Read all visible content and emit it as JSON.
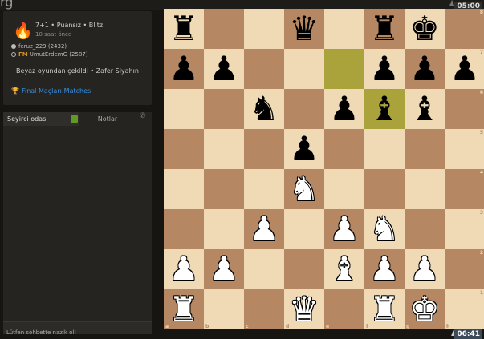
{
  "header": {
    "logo_fragment": "rg",
    "clock_top": "05:00",
    "clock_bottom": "06:41"
  },
  "game": {
    "title": "7+1 • Puansız • Blitz",
    "time_ago": "10 saat önce",
    "white_player": "feruz_229 (2432)",
    "black_title": "FM",
    "black_player": "UmutErdemG (2587)",
    "result": "Beyaz oyundan çekildi • Zafer Siyahın",
    "tournament": "Final Maçları-Matches"
  },
  "tabs": {
    "chat": "Seyirci odası",
    "notes": "Notlar"
  },
  "chat": {
    "placeholder": "Lütfen sohbette nazik ol!"
  },
  "board": {
    "ranks": [
      "8",
      "7",
      "6",
      "5",
      "4",
      "3",
      "2",
      "1"
    ],
    "files": [
      "a",
      "b",
      "c",
      "d",
      "e",
      "f",
      "g",
      "h"
    ],
    "highlights": [
      "e7",
      "f6"
    ],
    "position": [
      [
        "bR",
        "",
        "",
        "bQ",
        "",
        "bR",
        "bK",
        ""
      ],
      [
        "bP",
        "bP",
        "",
        "",
        "",
        "bP",
        "bP",
        "bP"
      ],
      [
        "",
        "",
        "bN",
        "",
        "bP",
        "bB",
        "bB",
        ""
      ],
      [
        "",
        "",
        "",
        "bP",
        "",
        "",
        "",
        ""
      ],
      [
        "",
        "",
        "",
        "wN",
        "",
        "",
        "",
        ""
      ],
      [
        "",
        "",
        "wP",
        "",
        "wP",
        "wN",
        "",
        ""
      ],
      [
        "wP",
        "wP",
        "",
        "",
        "wB",
        "wP",
        "wP",
        ""
      ],
      [
        "wR",
        "",
        "",
        "wQ",
        "",
        "wR",
        "wK",
        ""
      ]
    ],
    "glyphs": {
      "wK": "♚",
      "wQ": "♛",
      "wR": "♜",
      "wB": "♝",
      "wN": "♞",
      "wP": "♟",
      "bK": "♚",
      "bQ": "♛",
      "bR": "♜",
      "bB": "♝",
      "bN": "♞",
      "bP": "♟"
    },
    "colors": {
      "light": "#f0d9b5",
      "dark": "#b58863",
      "highlight": "#aaa23a"
    }
  }
}
